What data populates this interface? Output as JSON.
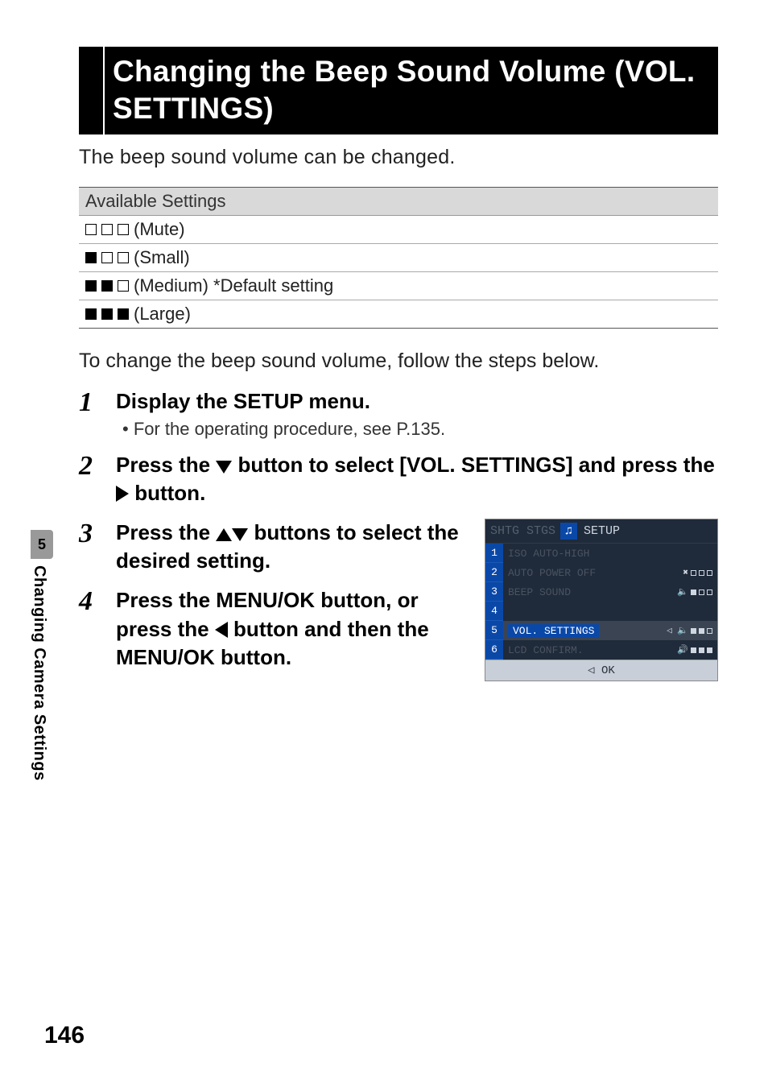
{
  "title": "Changing the Beep Sound Volume (VOL. SETTINGS)",
  "intro": "The beep sound volume can be changed.",
  "settings_header": "Available Settings",
  "settings": [
    {
      "fill": [
        0,
        0,
        0
      ],
      "label": " (Mute)"
    },
    {
      "fill": [
        1,
        0,
        0
      ],
      "label": " (Small)"
    },
    {
      "fill": [
        1,
        1,
        0
      ],
      "label": " (Medium) *Default setting"
    },
    {
      "fill": [
        1,
        1,
        1
      ],
      "label": " (Large)"
    }
  ],
  "lead": "To change the beep sound volume, follow the steps below.",
  "steps": {
    "s1": {
      "num": "1",
      "title": "Display the SETUP menu.",
      "sub": "• For the operating procedure, see P.135."
    },
    "s2": {
      "num": "2",
      "title_a": "Press the ",
      "title_b": " button to select [VOL. SETTINGS] and press the ",
      "title_c": " button."
    },
    "s3": {
      "num": "3",
      "title_a": "Press the ",
      "title_b": " buttons to select the desired setting."
    },
    "s4": {
      "num": "4",
      "title_a": "Press the MENU/OK button, or press the ",
      "title_b": " button and then the MENU/OK button."
    }
  },
  "lcd": {
    "top_dim": "SHTG STGS",
    "top_icon": "♫",
    "top_setup": "SETUP",
    "rows": [
      {
        "n": "1",
        "label": "ISO AUTO-HIGH",
        "sel": false
      },
      {
        "n": "2",
        "label": "AUTO POWER OFF",
        "sel": false,
        "spk": "✖",
        "fill": [
          0,
          0,
          0
        ]
      },
      {
        "n": "3",
        "label": "BEEP SOUND",
        "sel": false,
        "spk": "🔈",
        "fill": [
          1,
          0,
          0
        ]
      },
      {
        "n": "4",
        "label": "",
        "sel": false
      },
      {
        "n": "5",
        "label": "VOL. SETTINGS",
        "sel": true,
        "spk": "◁ 🔈",
        "fill": [
          1,
          1,
          0
        ]
      },
      {
        "n": "6",
        "label": "LCD CONFIRM.",
        "sel": false,
        "spk": "🔊",
        "fill": [
          1,
          1,
          1
        ]
      }
    ],
    "bottom": "◁  OK"
  },
  "side": {
    "num": "5",
    "caption": "Changing Camera Settings"
  },
  "page_num": "146"
}
